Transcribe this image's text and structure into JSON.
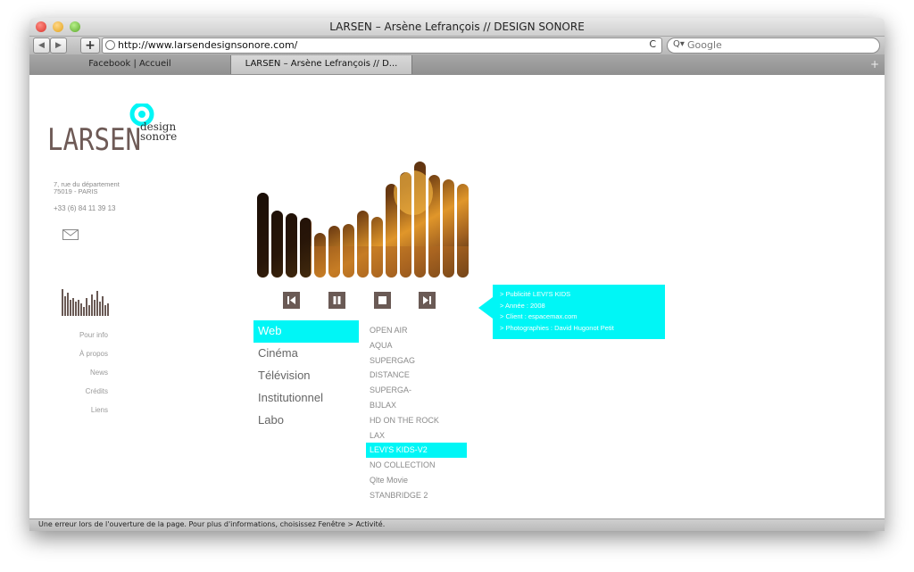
{
  "window": {
    "title": "LARSEN – Arsène Lefrançois // DESIGN SONORE"
  },
  "toolbar": {
    "back": "◀",
    "forward": "▶",
    "add": "+",
    "url": "http://www.larsendesignsonore.com/",
    "reload": "C",
    "search_placeholder": "Google",
    "search_glyph": "Q▾"
  },
  "tabs": [
    {
      "label": "Facebook | Accueil"
    },
    {
      "label": "LARSEN – Arsène Lefrançois // D..."
    }
  ],
  "tab_add": "+",
  "status": "Une erreur lors de l'ouverture de la page. Pour plus d'informations, choisissez Fenêtre > Activité.",
  "logo": {
    "word": "LARSEN",
    "tag1": "design",
    "tag2": "sonore"
  },
  "contact": {
    "address1": "7, rue du département",
    "address2": "75019 - PARIS",
    "phone": "+33 (6) 84 11 39 13"
  },
  "side_menu": [
    "Pour info",
    "À propos",
    "News",
    "Crédits",
    "Liens"
  ],
  "categories": [
    {
      "label": "Web",
      "active": true
    },
    {
      "label": "Cinéma",
      "active": false
    },
    {
      "label": "Télévision",
      "active": false
    },
    {
      "label": "Institutionnel",
      "active": false
    },
    {
      "label": "Labo",
      "active": false
    }
  ],
  "projects": [
    {
      "label": "OPEN AIR",
      "active": false
    },
    {
      "label": "AQUA",
      "active": false
    },
    {
      "label": "SUPERGAG",
      "active": false
    },
    {
      "label": "DISTANCE",
      "active": false
    },
    {
      "label": "SUPERGA-",
      "active": false
    },
    {
      "label": "BIJLAX",
      "active": false
    },
    {
      "label": "HD ON THE ROCK",
      "active": false
    },
    {
      "label": "LAX",
      "active": false
    },
    {
      "label": "LEVI'S KIDS-V2",
      "active": true
    },
    {
      "label": "NO COLLECTION",
      "active": false
    },
    {
      "label": "Qlte Movie",
      "active": false
    },
    {
      "label": "STANBRIDGE 2",
      "active": false
    }
  ],
  "info": [
    "> Publicité LEVI'S KIDS",
    "> Année : 2008",
    "> Client : espacemax.com",
    "> Photographies : David Hugonot Petit"
  ],
  "colors": {
    "accent": "#00f6f6",
    "logo_brown": "#6e5a56",
    "control": "#6a5a55"
  }
}
